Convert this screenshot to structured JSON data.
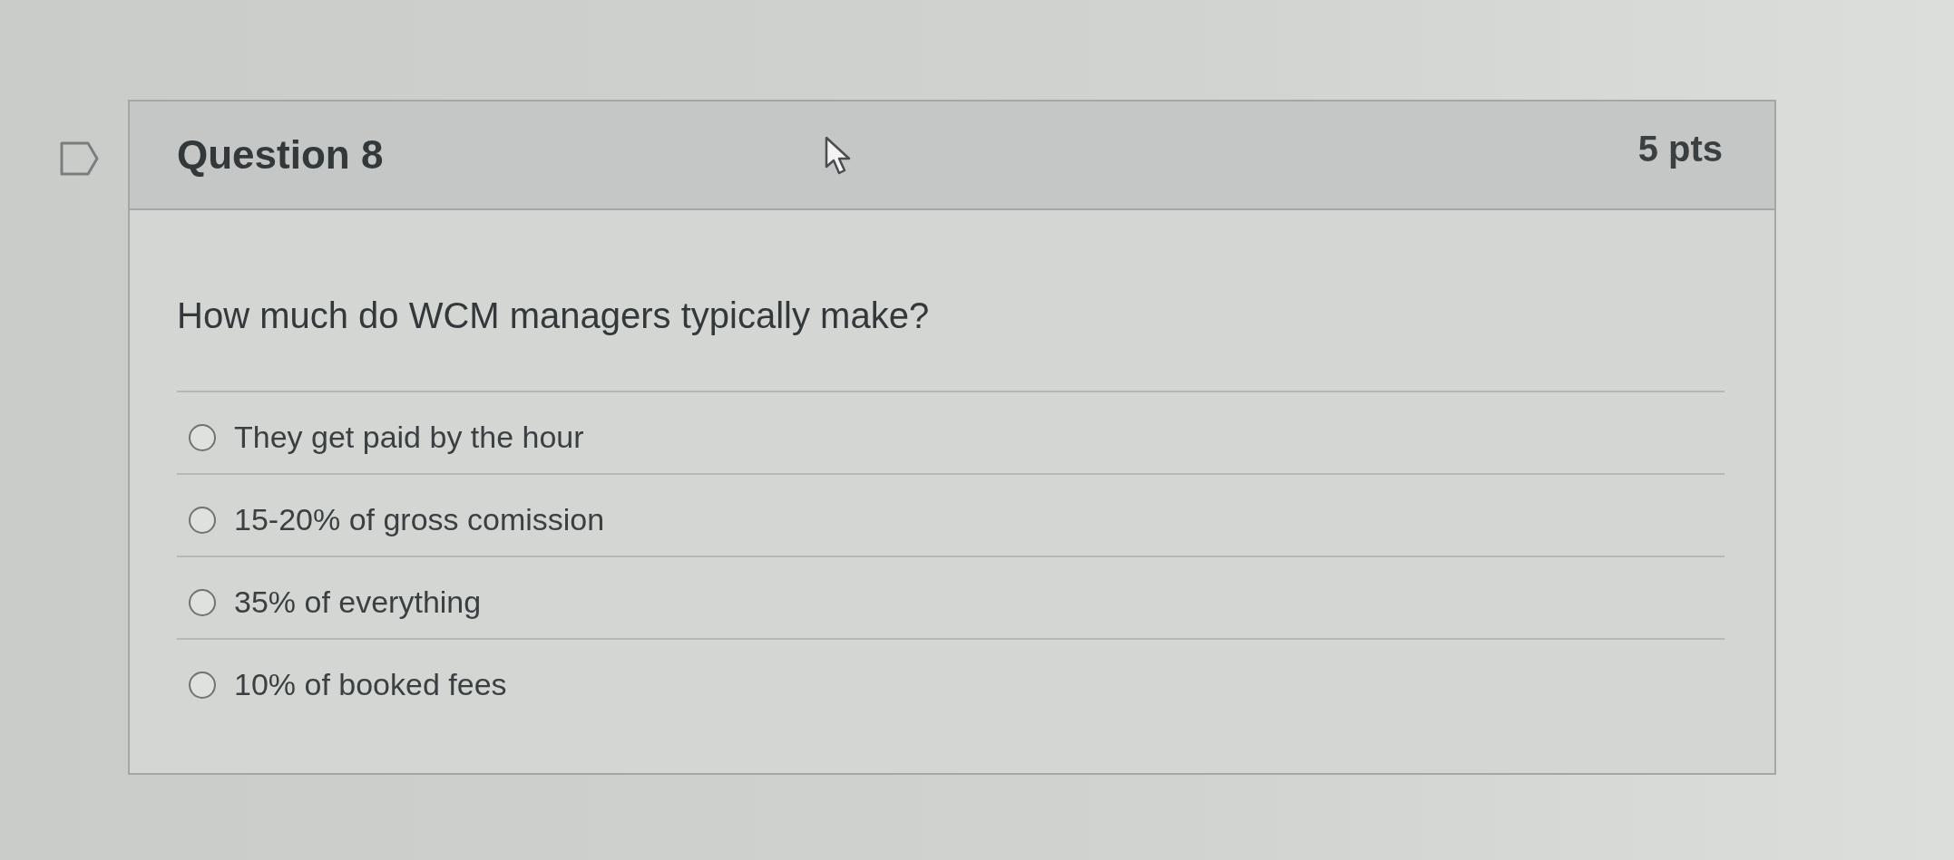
{
  "question": {
    "title": "Question 8",
    "points": "5 pts",
    "text": "How much do WCM managers typically make?",
    "answers": [
      {
        "label": "They get paid by the hour",
        "selected": false
      },
      {
        "label": "15-20% of gross comission",
        "selected": false
      },
      {
        "label": "35% of everything",
        "selected": false
      },
      {
        "label": "10% of booked fees",
        "selected": false
      }
    ]
  }
}
